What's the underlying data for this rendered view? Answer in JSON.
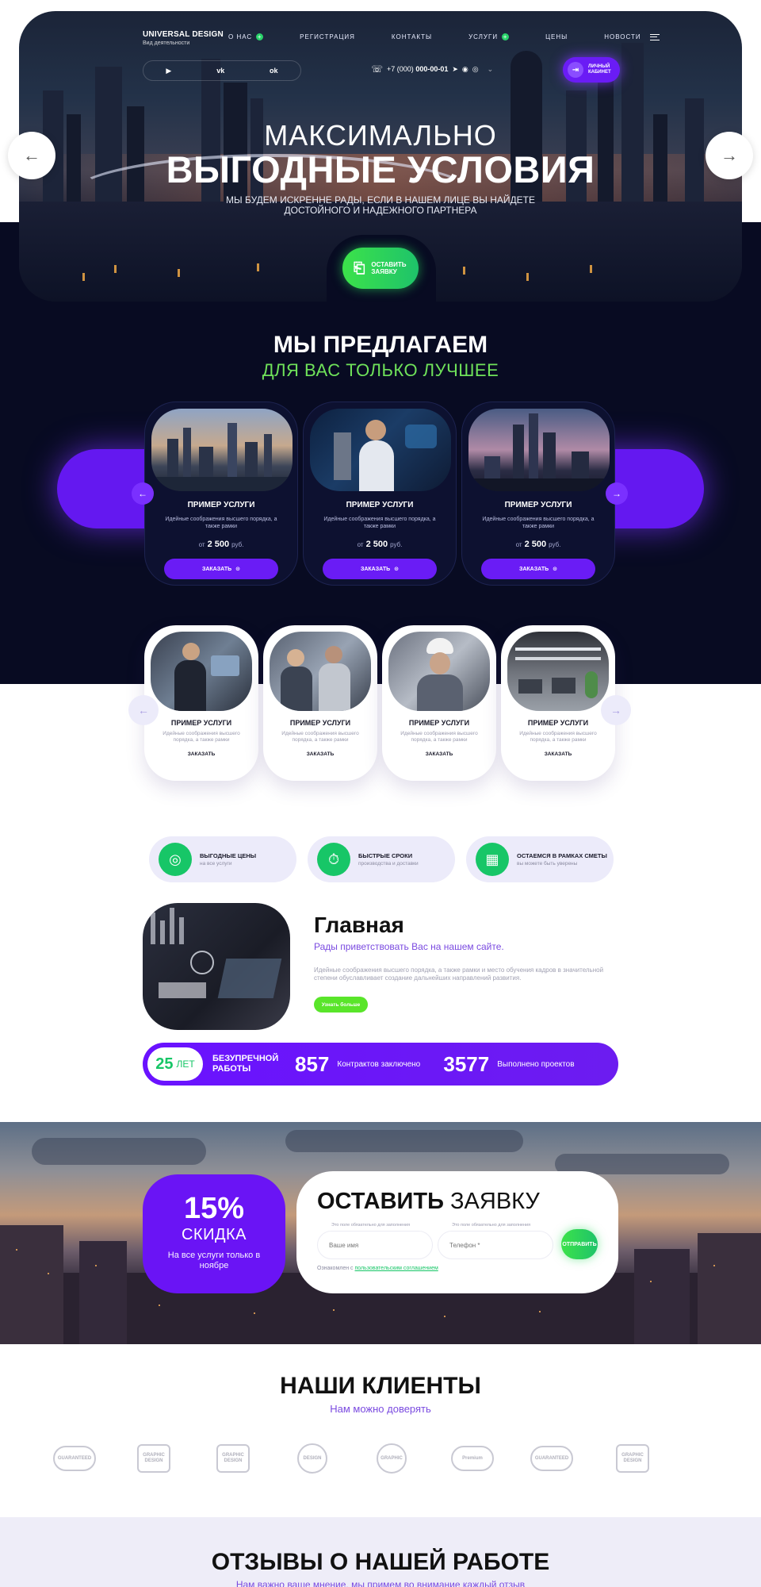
{
  "header": {
    "brand": "UNIVERSAL DESIGN",
    "brand_sub": "Вид деятельности",
    "nav": [
      {
        "label": "О НАС",
        "plus": true
      },
      {
        "label": "РЕГИСТРАЦИЯ",
        "plus": false
      },
      {
        "label": "КОНТАКТЫ",
        "plus": false
      },
      {
        "label": "УСЛУГИ",
        "plus": true
      },
      {
        "label": "ЦЕНЫ",
        "plus": false
      },
      {
        "label": "НОВОСТИ",
        "plus": false
      }
    ],
    "socials": [
      "▶",
      "vk",
      "ok"
    ],
    "phone_prefix": "+7 (000)",
    "phone_number": "000-00-01",
    "cabinet_label": "ЛИЧНЫЙ КАБИНЕТ",
    "icons": [
      "phone-icon",
      "telegram-icon",
      "whatsapp-icon",
      "viber-icon",
      "chevron-down-icon",
      "login-icon",
      "burger-menu-icon"
    ]
  },
  "hero": {
    "title_line1": "МАКСИМАЛЬНО",
    "title_line2": "ВЫГОДНЫЕ УСЛОВИЯ",
    "subtitle": "МЫ БУДЕМ ИСКРЕННЕ РАДЫ, ЕСЛИ В НАШЕМ ЛИЦЕ ВЫ НАЙДЕТЕ ДОСТОЙНОГО И НАДЕЖНОГО ПАРТНЕРА",
    "cta_label": "ОСТАВИТЬ ЗАЯВКУ"
  },
  "offer": {
    "title": "МЫ ПРЕДЛАГАЕМ",
    "subtitle": "ДЛЯ ВАС ТОЛЬКО ЛУЧШЕЕ",
    "cards": [
      {
        "title": "ПРИМЕР УСЛУГИ",
        "desc": "Идейные соображения высшего порядка, а также рамки",
        "price_from": "от",
        "price": "2 500",
        "currency": "руб.",
        "button": "ЗАКАЗАТЬ"
      },
      {
        "title": "ПРИМЕР УСЛУГИ",
        "desc": "Идейные соображения высшего порядка, а также рамки",
        "price_from": "от",
        "price": "2 500",
        "currency": "руб.",
        "button": "ЗАКАЗАТЬ"
      },
      {
        "title": "ПРИМЕР УСЛУГИ",
        "desc": "Идейные соображения высшего порядка, а также рамки",
        "price_from": "от",
        "price": "2 500",
        "currency": "руб.",
        "button": "ЗАКАЗАТЬ"
      }
    ]
  },
  "services": {
    "cards": [
      {
        "title": "ПРИМЕР УСЛУГИ",
        "desc": "Идейные соображения высшего порядка, а также рамки",
        "button": "ЗАКАЗАТЬ"
      },
      {
        "title": "ПРИМЕР УСЛУГИ",
        "desc": "Идейные соображения высшего порядка, а также рамки",
        "button": "ЗАКАЗАТЬ"
      },
      {
        "title": "ПРИМЕР УСЛУГИ",
        "desc": "Идейные соображения высшего порядка, а также рамки",
        "button": "ЗАКАЗАТЬ"
      },
      {
        "title": "ПРИМЕР УСЛУГИ",
        "desc": "Идейные соображения высшего порядка, а также рамки",
        "button": "ЗАКАЗАТЬ"
      }
    ]
  },
  "features": [
    {
      "title": "ВЫГОДНЫЕ ЦЕНЫ",
      "sub": "на все услуги",
      "icon": "coin-icon"
    },
    {
      "title": "БЫСТРЫЕ СРОКИ",
      "sub": "производства и доставки",
      "icon": "stopwatch-icon"
    },
    {
      "title": "ОСТАЕМСЯ В РАМКАХ СМЕТЫ",
      "sub": "вы можете быть уверены",
      "icon": "calendar-icon"
    }
  ],
  "about": {
    "title": "Главная",
    "subtitle": "Рады приветствовать Вас на нашем сайте.",
    "text": "Идейные соображения высшего порядка, а также рамки и место обучения кадров в значительной степени обуславливает создание дальнейших направлений развития.",
    "button": "Узнать больше"
  },
  "stats": {
    "years_value": "25",
    "years_unit": "ЛЕТ",
    "years_label": "БЕЗУПРЕЧНОЙ РАБОТЫ",
    "items": [
      {
        "value": "857",
        "label": "Контрактов заключено"
      },
      {
        "value": "3577",
        "label": "Выполнено проектов"
      }
    ]
  },
  "discount": {
    "value": "15%",
    "word": "СКИДКА",
    "desc": "На все услуги только в ноябре"
  },
  "request_form": {
    "title_bold": "ОСТАВИТЬ",
    "title_rest": "ЗАЯВКУ",
    "field_hint": "Это поле обязательно для заполнения",
    "name_placeholder": "Ваше имя",
    "phone_placeholder": "Телефон *",
    "submit": "ОТПРАВИТЬ",
    "agree_text": "Ознакомлен с",
    "agree_link": "пользовательским соглашением"
  },
  "clients": {
    "title": "НАШИ КЛИЕНТЫ",
    "subtitle": "Нам можно доверять",
    "logos": [
      "GUARANTEED",
      "GRAPHIC DESIGN",
      "GRAPHIC DESIGN",
      "DESIGN",
      "GRAPHIC",
      "Premium",
      "GUARANTEED",
      "GRAPHIC DESIGN"
    ]
  },
  "reviews": {
    "title": "ОТЗЫВЫ О НАШЕЙ РАБОТЕ",
    "subtitle": "Нам важно ваше мнение, мы примем во внимание каждый отзыв"
  },
  "colors": {
    "purple": "#6a1cf5",
    "green": "#29d36a",
    "dark": "#080b22"
  }
}
